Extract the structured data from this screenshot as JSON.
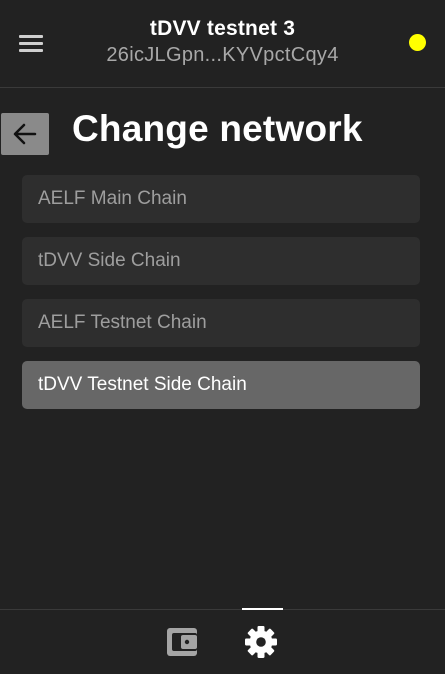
{
  "header": {
    "wallet_name": "tDVV testnet 3",
    "wallet_address": "26icJLGpn...KYVpctCqy4",
    "menu_icon": "hamburger-menu-icon",
    "status_color": "#ffff00"
  },
  "page": {
    "title": "Change network",
    "back_icon": "arrow-left-icon"
  },
  "networks": [
    {
      "label": "AELF Main Chain",
      "selected": false
    },
    {
      "label": "tDVV Side Chain",
      "selected": false
    },
    {
      "label": "AELF Testnet Chain",
      "selected": false
    },
    {
      "label": "tDVV Testnet Side Chain",
      "selected": true
    }
  ],
  "bottom_nav": {
    "items": [
      {
        "icon": "wallet-icon",
        "active": false
      },
      {
        "icon": "gear-icon",
        "active": true
      }
    ]
  },
  "colors": {
    "background": "#222222",
    "selected_item": "#676767",
    "item": "#2e2e2e",
    "status_dot": "#ffff00"
  }
}
